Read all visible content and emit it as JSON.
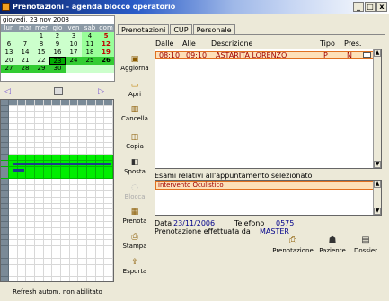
{
  "window": {
    "title": "Prenotazioni - agenda blocco operatorio",
    "controls": [
      "_",
      "□",
      "x"
    ]
  },
  "calendar": {
    "title": "giovedì, 23 nov 2008",
    "headers": [
      "lun",
      "mar",
      "mer",
      "gio",
      "ven",
      "sab",
      "dom"
    ],
    "rows": [
      [
        "",
        "",
        "1",
        "2",
        "3",
        "4",
        "5"
      ],
      [
        "6",
        "7",
        "8",
        "9",
        "10",
        "11",
        "12"
      ],
      [
        "13",
        "14",
        "15",
        "16",
        "17",
        "18",
        "19"
      ],
      [
        "20",
        "21",
        "22",
        "23",
        "24",
        "25",
        "26"
      ],
      [
        "27",
        "28",
        "29",
        "30",
        "",
        "",
        ""
      ]
    ]
  },
  "tabs": [
    "Prenotazioni",
    "CUP",
    "Personale"
  ],
  "toolbar": [
    "Aggiorna",
    "Apri",
    "Cancella",
    "Copia",
    "Sposta",
    "Blocca",
    "Prenota",
    "Stampa",
    "Esporta"
  ],
  "columns": {
    "dalle": "Dalle",
    "alle": "Alle",
    "descrizione": "Descrizione",
    "tipo": "Tipo",
    "pres": "Pres."
  },
  "appointments": [
    {
      "dalle": "08:10",
      "alle": "09:10",
      "descrizione": "ASTARITA LORENZO",
      "tipo": "P",
      "pres": "N"
    }
  ],
  "exams": {
    "label": "Esami relativi all'appuntamento selezionato",
    "items": [
      "intervento Oculistico"
    ]
  },
  "details": {
    "data_label": "Data",
    "data_value": "23/11/2006",
    "telefono_label": "Telefono",
    "telefono_value": "0575",
    "effettuata_label": "Prenotazione effettuata da",
    "effettuata_value": "MASTER"
  },
  "bottom_buttons": [
    "Prenotazione",
    "Paziente",
    "Dossier"
  ],
  "status": "Refresh autom. non abilitato"
}
